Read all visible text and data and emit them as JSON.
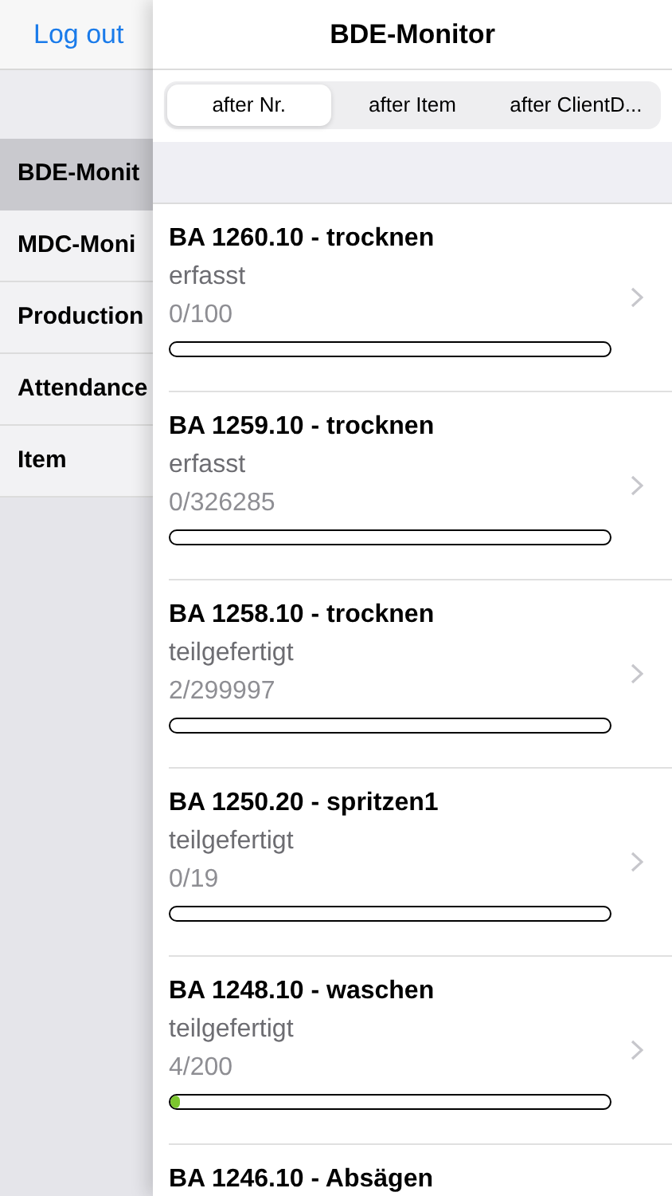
{
  "sidebar": {
    "logout": "Log out",
    "items": [
      {
        "label": "BDE-Monit",
        "selected": true
      },
      {
        "label": "MDC-Moni",
        "selected": false
      },
      {
        "label": "Production",
        "selected": false
      },
      {
        "label": "Attendance",
        "selected": false
      },
      {
        "label": "Item",
        "selected": false
      }
    ]
  },
  "panel": {
    "title": "BDE-Monitor",
    "segments": [
      {
        "label": "after Nr.",
        "selected": true
      },
      {
        "label": "after Item",
        "selected": false
      },
      {
        "label": "after ClientD...",
        "selected": false
      }
    ],
    "orders": [
      {
        "title": "BA 1260.10 - trocknen",
        "status": "erfasst",
        "count": "0/100",
        "level": 0
      },
      {
        "title": "BA 1259.10 - trocknen",
        "status": "erfasst",
        "count": "0/326285",
        "level": 0
      },
      {
        "title": "BA 1258.10 - trocknen",
        "status": "teilgefertigt",
        "count": "2/299997",
        "level": 0
      },
      {
        "title": "BA 1250.20 - spritzen1",
        "status": "teilgefertigt",
        "count": "0/19",
        "level": 0
      },
      {
        "title": "BA 1248.10 - waschen",
        "status": "teilgefertigt",
        "count": "4/200",
        "level": 0.02
      },
      {
        "title": "BA 1246.10 - Absägen"
      }
    ]
  }
}
